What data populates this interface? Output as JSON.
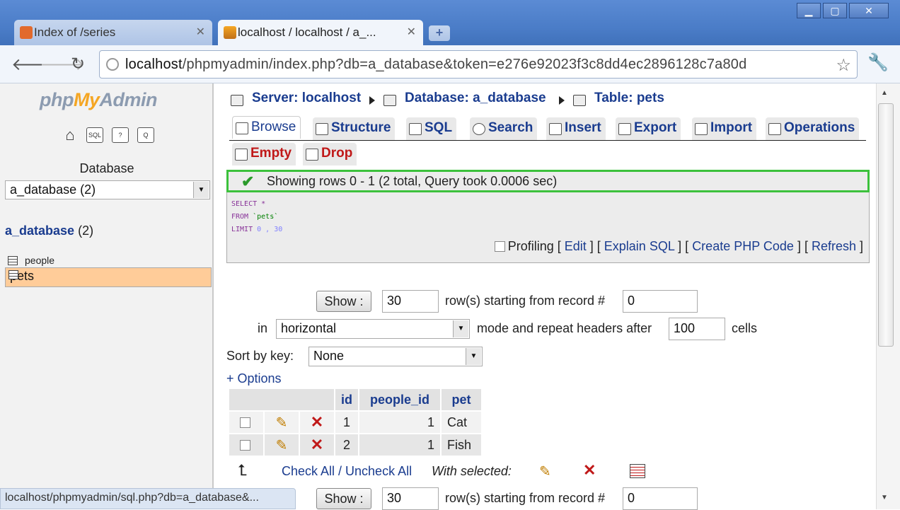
{
  "browser": {
    "tabs": [
      {
        "title": "Index of /series",
        "active": false
      },
      {
        "title": "localhost / localhost / a_...",
        "active": true
      }
    ],
    "url_host": "localhost",
    "url_path": "/phpmyadmin/index.php?db=a_database&token=e276e92023f3c8dd4ec2896128c7a80d",
    "status_url": "localhost/phpmyadmin/sql.php?db=a_database&..."
  },
  "sidebar": {
    "logo": {
      "php": "php",
      "my": "My",
      "admin": "Admin"
    },
    "icons": [
      "home-icon",
      "sql-icon",
      "query-icon",
      "docs-icon"
    ],
    "icon_labels": [
      "⌂",
      "SQL",
      "?",
      "Q"
    ],
    "database_label": "Database",
    "database_select": "a_database (2)",
    "db_link": "a_database",
    "db_count": "(2)",
    "tables": [
      {
        "name": "people",
        "selected": false
      },
      {
        "name": "pets",
        "selected": true
      }
    ]
  },
  "breadcrumb": {
    "server": "Server: localhost",
    "database": "Database: a_database",
    "table": "Table: pets"
  },
  "tabs": [
    "Browse",
    "Structure",
    "SQL",
    "Search",
    "Insert",
    "Export",
    "Import",
    "Operations",
    "Empty",
    "Drop"
  ],
  "success_message": "Showing rows 0 - 1 (2 total, Query took 0.0006 sec)",
  "sql": {
    "select": "SELECT *",
    "from_kw": "FROM",
    "from_tbl": "`pets`",
    "limit_kw": "LIMIT",
    "limit_vals": "0 , 30"
  },
  "sql_links": {
    "profiling": "Profiling",
    "edit": "Edit",
    "explain": "Explain SQL",
    "php": "Create PHP Code",
    "refresh": "Refresh"
  },
  "nav": {
    "show": "Show :",
    "rows": "30",
    "starting_text": "row(s) starting from record #",
    "start": "0",
    "in": "in",
    "mode": "horizontal",
    "mode_text": "mode and repeat headers after",
    "repeat": "100",
    "cells": "cells"
  },
  "sort": {
    "label": "Sort by key:",
    "value": "None"
  },
  "options": "+ Options",
  "table": {
    "headers": [
      "id",
      "people_id",
      "pet"
    ],
    "rows": [
      {
        "id": "1",
        "people_id": "1",
        "pet": "Cat"
      },
      {
        "id": "2",
        "people_id": "1",
        "pet": "Fish"
      }
    ]
  },
  "footer": {
    "check_all": "Check All / Uncheck All",
    "with_selected": "With selected:"
  },
  "nav_bottom": {
    "show": "Show :",
    "rows": "30",
    "starting_text": "row(s) starting from record #",
    "start": "0"
  }
}
